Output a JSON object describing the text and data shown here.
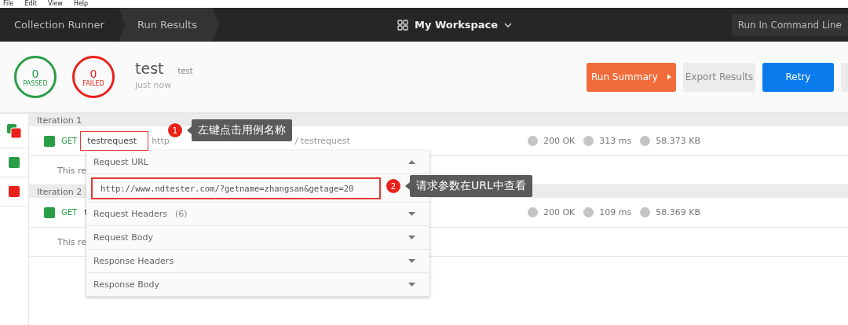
{
  "menu_bar": [
    "File",
    "Edit",
    "View",
    "Help"
  ],
  "breadcrumbs": [
    {
      "label": "Collection Runner",
      "selected": false
    },
    {
      "label": "Run Results",
      "selected": true
    }
  ],
  "workspace": "My Workspace",
  "command_line_button": "Run In Command Line",
  "summary": {
    "passed": {
      "count": "0",
      "label": "PASSED"
    },
    "failed": {
      "count": "0",
      "label": "FAILED"
    },
    "name": "test",
    "environment": "test",
    "time": "just now"
  },
  "actions": [
    {
      "kind": "summary",
      "label": "Run Summary"
    },
    {
      "kind": "secondary",
      "label": "Export Results"
    },
    {
      "kind": "primary",
      "label": "Retry"
    },
    {
      "kind": "partial"
    }
  ],
  "iteration_list": [
    {
      "kind": "mixed"
    },
    {
      "kind": "single",
      "color": "#2a9d47"
    },
    {
      "kind": "single",
      "color": "#e8211a"
    }
  ],
  "iterations": [
    {
      "title": "Iteration 1",
      "requests": [
        {
          "color": "#2a9d47",
          "method": "GET",
          "name": "testrequest",
          "highlighted": true,
          "url": "http",
          "path": "/ testrequest",
          "status_code": "200 OK",
          "time": "313 ms",
          "size": "58.373 KB",
          "message": "This re"
        }
      ]
    },
    {
      "title": "Iteration 2",
      "requests": [
        {
          "color": "#2a9d47",
          "method": "GET",
          "name": "t",
          "highlighted": false,
          "status_code": "200 OK",
          "time": "109 ms",
          "size": "58.369 KB",
          "message": "This re"
        }
      ]
    }
  ],
  "request_popup": {
    "sections": [
      {
        "title": "Request URL",
        "expanded": true,
        "value": "http://www.ndtester.com/?getname=zhangsan&getage=20",
        "highlighted": true
      },
      {
        "title": "Request Headers",
        "count": "(6)",
        "expanded": false
      },
      {
        "title": "Request Body",
        "expanded": false
      },
      {
        "title": "Response Headers",
        "expanded": false
      },
      {
        "title": "Response Body",
        "expanded": false
      }
    ]
  },
  "annotations": [
    {
      "number": "1",
      "text": "左键点击用例名称"
    },
    {
      "number": "2",
      "text": "请求参数在URL中查看"
    }
  ]
}
